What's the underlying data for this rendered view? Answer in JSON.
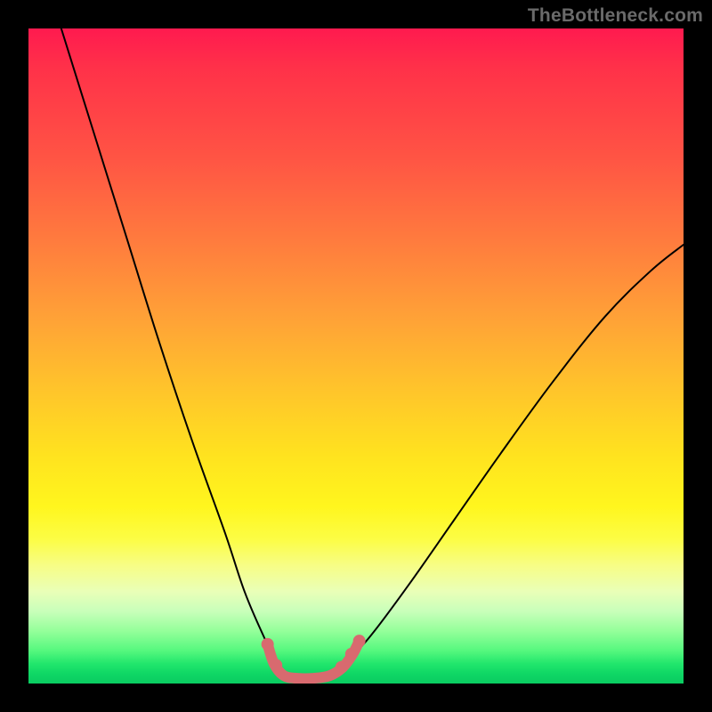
{
  "attribution": "TheBottleneck.com",
  "chart_data": {
    "type": "line",
    "title": "",
    "xlabel": "",
    "ylabel": "",
    "xlim": [
      0,
      100
    ],
    "ylim": [
      0,
      100
    ],
    "background_gradient": {
      "top_color": "#ff1a4f",
      "mid_color": "#fff61e",
      "bottom_color": "#0acc61"
    },
    "series": [
      {
        "name": "bottleneck-curve",
        "stroke": "#000000",
        "stroke_width": 2,
        "x": [
          5,
          10,
          15,
          20,
          25,
          30,
          33,
          36,
          38,
          40,
          42,
          45,
          48,
          52,
          58,
          65,
          72,
          80,
          88,
          95,
          100
        ],
        "y": [
          100,
          84,
          68,
          52,
          37,
          23,
          14,
          7,
          3,
          1,
          1,
          1,
          3,
          7,
          15,
          25,
          35,
          46,
          56,
          63,
          67
        ]
      },
      {
        "name": "optimal-range-marker",
        "stroke": "#d86a6f",
        "stroke_width": 12,
        "x": [
          36.5,
          37.5,
          39,
          41,
          43.5,
          46,
          48,
          49.5,
          50.5
        ],
        "y": [
          6.0,
          3.0,
          1.2,
          0.8,
          0.8,
          1.2,
          2.5,
          4.5,
          6.5
        ]
      }
    ],
    "marker_points": {
      "stroke": "#d86a6f",
      "radius": 7,
      "points": [
        {
          "x": 36.5,
          "y": 6.0
        },
        {
          "x": 37.8,
          "y": 2.8
        },
        {
          "x": 47.8,
          "y": 2.5
        },
        {
          "x": 49.3,
          "y": 4.5
        },
        {
          "x": 50.5,
          "y": 6.5
        }
      ]
    }
  }
}
